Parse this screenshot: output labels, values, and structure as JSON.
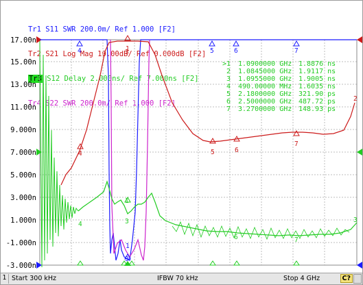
{
  "traces": [
    {
      "id": "Tr1",
      "param": "S11",
      "format": "SWR",
      "scale": "200.0m/",
      "ref": "Ref 1.000",
      "channel": "[F2]",
      "color": "#1a1aff"
    },
    {
      "id": "Tr2",
      "param": "S21",
      "format": "Log Mag",
      "scale": "10.00dB/",
      "ref": "Ref 0.000dB",
      "channel": "[F2]",
      "color": "#cc1a1a"
    },
    {
      "id": "Tr3",
      "param": "S12",
      "format": "Delay",
      "scale": "2.000ns/",
      "ref": "Ref 7.000ns",
      "channel": "[F2]",
      "color": "#22cc22"
    },
    {
      "id": "Tr4",
      "param": "S22",
      "format": "SWR",
      "scale": "200.0m/",
      "ref": "Ref 1.000",
      "channel": "[F2]",
      "color": "#cc22cc"
    }
  ],
  "y_ticks": [
    "17.00n",
    "15.00n",
    "13.00n",
    "11.00n",
    "9.000n",
    "7.000n",
    "5.000n",
    "3.000n",
    "1.000n",
    "-1.000n",
    "-3.000n"
  ],
  "markers": [
    {
      "num": ">1",
      "freq": "1.0900000 GHz",
      "value": "1.8876 ns"
    },
    {
      "num": "2",
      "freq": "1.0845000 GHz",
      "value": "1.9117 ns"
    },
    {
      "num": "3",
      "freq": "1.0955000 GHz",
      "value": "1.9005 ns"
    },
    {
      "num": "4",
      "freq": "490.00000 MHz",
      "value": "1.6035 ns"
    },
    {
      "num": "5",
      "freq": "2.1800000 GHz",
      "value": "321.90 ps"
    },
    {
      "num": "6",
      "freq": "2.5000000 GHz",
      "value": "487.72 ps"
    },
    {
      "num": "7",
      "freq": "3.2700000 GHz",
      "value": "148.93 ps"
    }
  ],
  "right_ref_labels": {
    "red": "2",
    "green": "3"
  },
  "status": {
    "channel": "1",
    "start": "Start 300 kHz",
    "ifbw": "IFBW 70 kHz",
    "stop": "Stop 4 GHz",
    "badge": "C?"
  },
  "colors": {
    "grid": "#bdbdbd",
    "s11": "#1a1aff",
    "s21": "#cc1a1a",
    "s12": "#22cc22",
    "s22": "#cc22cc"
  }
}
